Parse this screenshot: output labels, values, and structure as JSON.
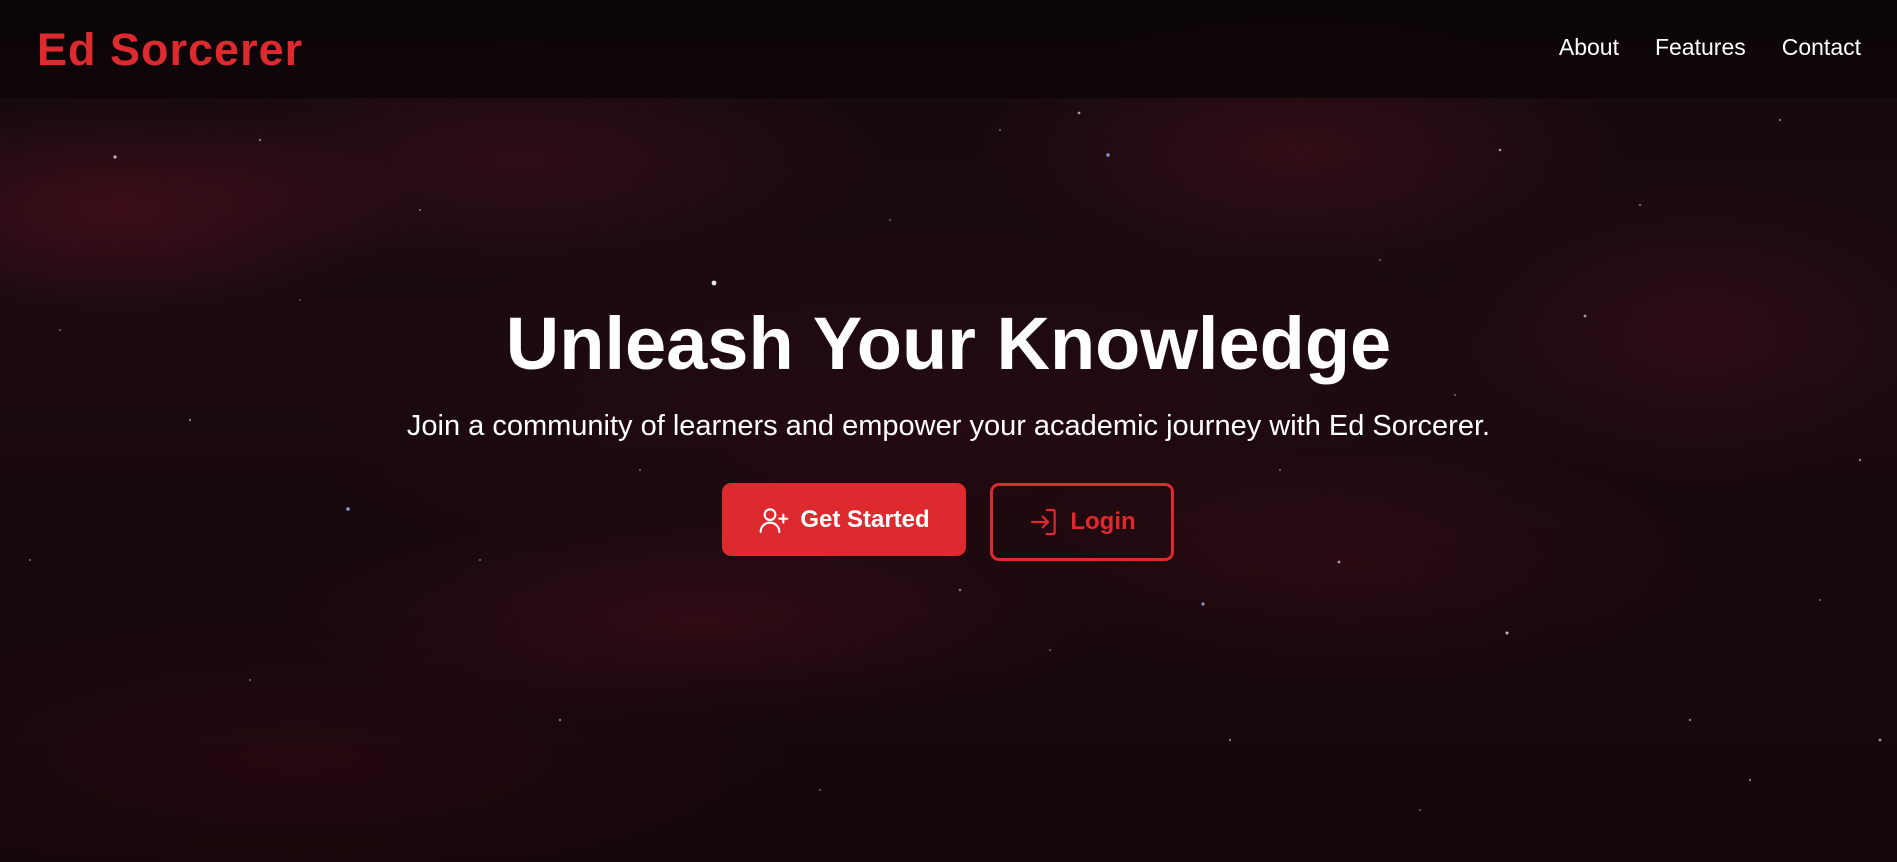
{
  "header": {
    "logo": "Ed Sorcerer",
    "nav": [
      {
        "label": "About"
      },
      {
        "label": "Features"
      },
      {
        "label": "Contact"
      }
    ]
  },
  "hero": {
    "title": "Unleash Your Knowledge",
    "subtitle": "Join a community of learners and empower your academic journey with Ed Sorcerer.",
    "buttons": {
      "primary": {
        "label": "Get Started",
        "icon": "user-plus-icon"
      },
      "secondary": {
        "label": "Login",
        "icon": "login-icon"
      }
    }
  },
  "colors": {
    "accent": "#dc2a2e",
    "background": "#160a0d",
    "text": "#ffffff"
  }
}
